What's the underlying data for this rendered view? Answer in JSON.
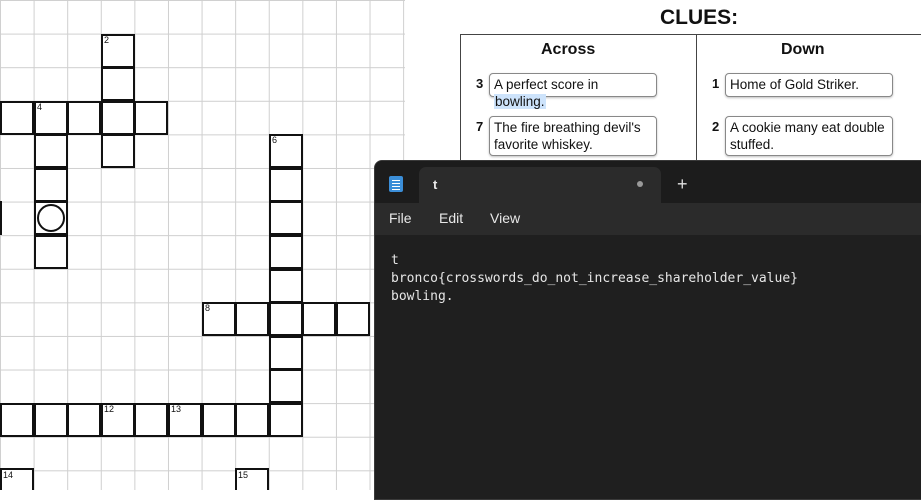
{
  "crossword": {
    "numbers": [
      "2",
      "4",
      "6",
      "8",
      "12",
      "13",
      "14",
      "15"
    ]
  },
  "clues": {
    "title": "CLUES:",
    "across_label": "Across",
    "down_label": "Down",
    "across": [
      {
        "num": "3",
        "text_pre": "A perfect score in ",
        "text_hl": "bowling.",
        "text_post": ""
      },
      {
        "num": "7",
        "text": "The fire breathing devil's favorite whiskey."
      }
    ],
    "down": [
      {
        "num": "1",
        "text": "Home of Gold Striker."
      },
      {
        "num": "2",
        "text": "A cookie many eat double stuffed."
      }
    ]
  },
  "notepad": {
    "tab_title": "t",
    "menu": {
      "file": "File",
      "edit": "Edit",
      "view": "View"
    },
    "lines": [
      "t",
      "bronco{crosswords_do_not_increase_shareholder_value}",
      "bowling."
    ]
  },
  "colors": {
    "notepad_bg": "#202020",
    "highlight": "#cde3fb",
    "notepad_icon": "#3b8ed8"
  }
}
